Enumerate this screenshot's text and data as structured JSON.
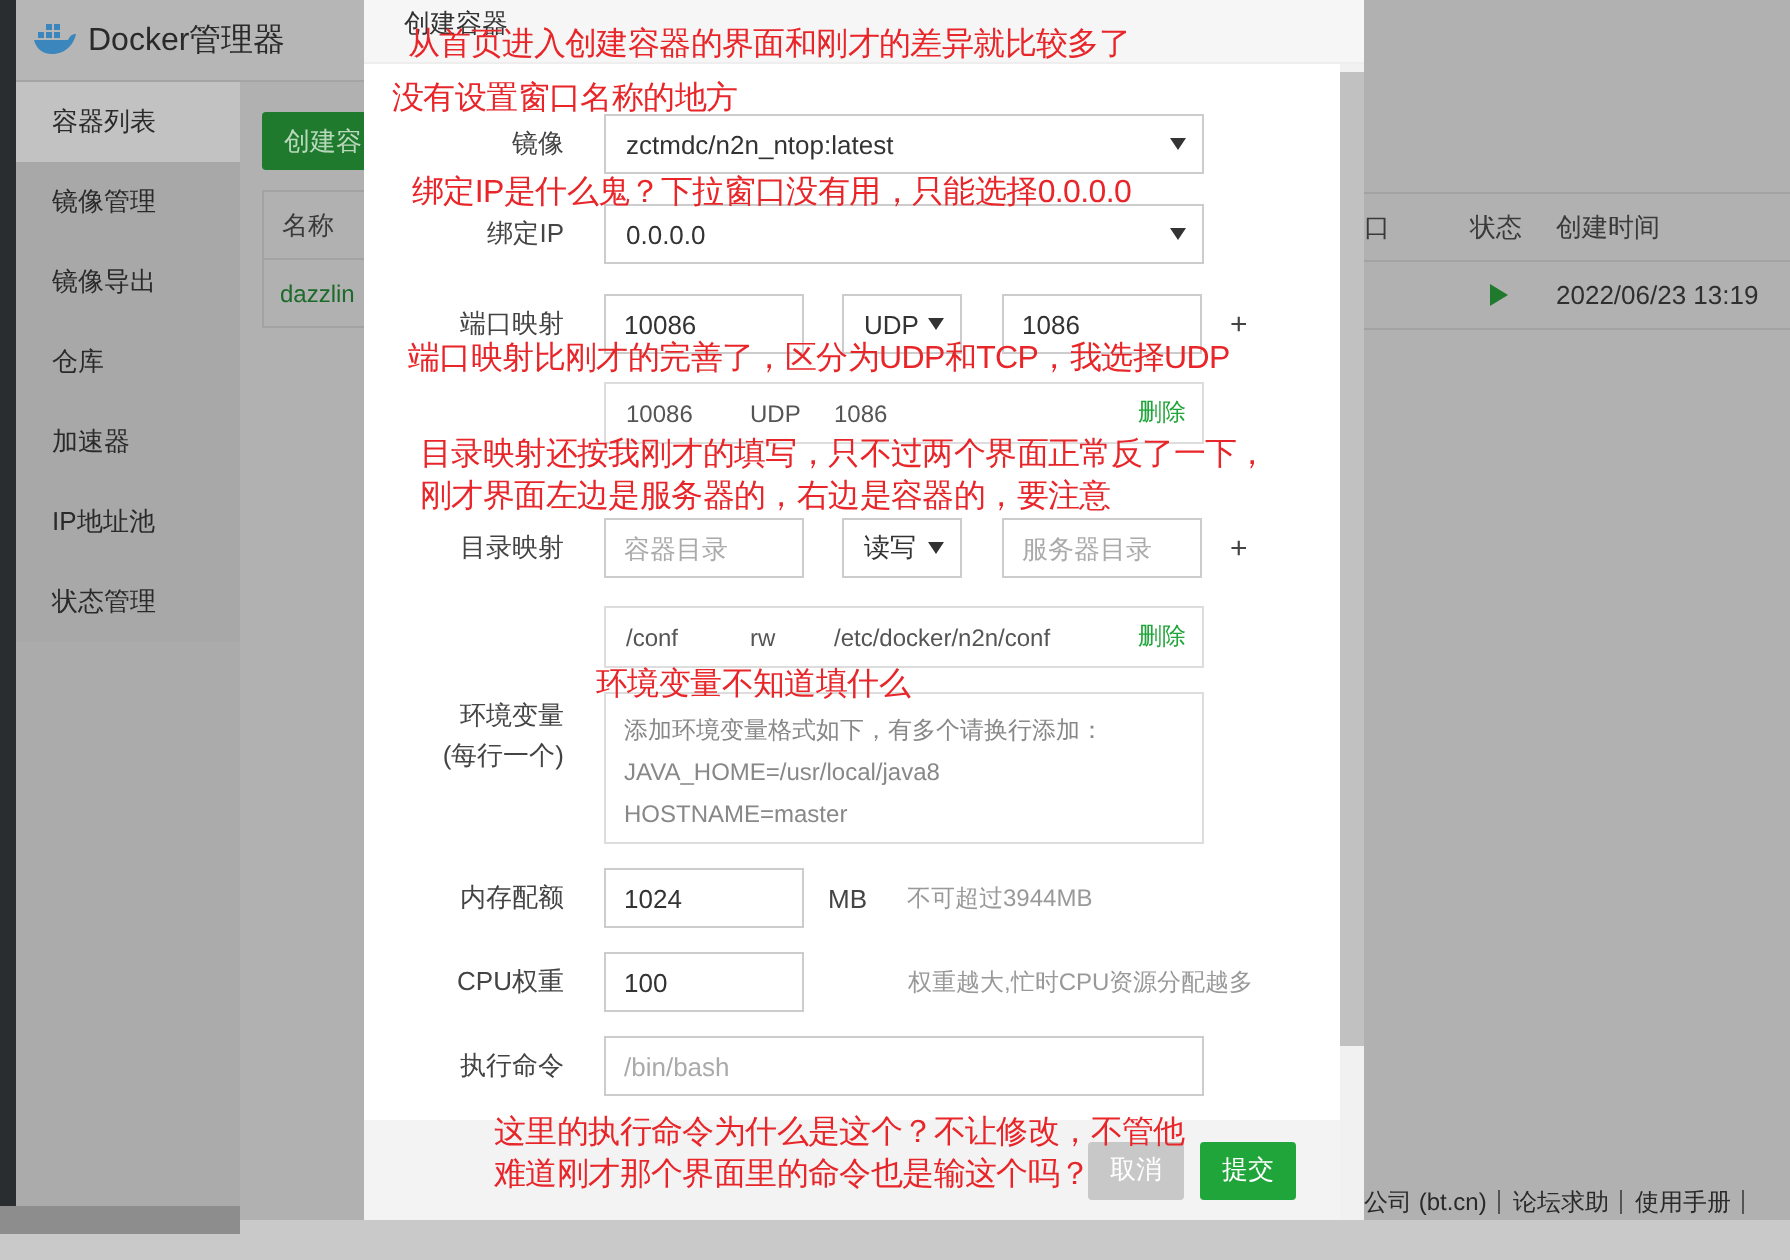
{
  "app": {
    "title": "Docker管理器",
    "sidebar": [
      {
        "label": "容器列表",
        "selected": true
      },
      {
        "label": "镜像管理",
        "selected": false
      },
      {
        "label": "镜像导出",
        "selected": false
      },
      {
        "label": "仓库",
        "selected": false
      },
      {
        "label": "加速器",
        "selected": false
      },
      {
        "label": "IP地址池",
        "selected": false
      },
      {
        "label": "状态管理",
        "selected": false
      }
    ],
    "create_button": "创建容",
    "table": {
      "columns": [
        "名称",
        "口",
        "状态",
        "创建时间"
      ],
      "rows": [
        {
          "name": "dazzlin",
          "running": true,
          "created": "2022/06/23 13:19"
        }
      ]
    },
    "footer_links": [
      "公司 (bt.cn)",
      "论坛求助",
      "使用手册"
    ]
  },
  "dialog": {
    "title": "创建容器",
    "fields": [
      {
        "kind": "select",
        "label": "镜像",
        "value": "zctmdc/n2n_ntop:latest"
      },
      {
        "kind": "select",
        "label": "绑定IP",
        "value": "0.0.0.0"
      },
      {
        "kind": "mapping",
        "label": "端口映射",
        "inputs": [
          {
            "kind": "input",
            "value": "10086"
          },
          {
            "kind": "select",
            "value": "UDP"
          },
          {
            "kind": "input",
            "value": "1086"
          }
        ],
        "add": "+",
        "entries": [
          {
            "cells": [
              "10086",
              "UDP",
              "1086"
            ],
            "delete": "删除"
          }
        ]
      },
      {
        "kind": "mapping",
        "label": "目录映射",
        "inputs": [
          {
            "kind": "input",
            "placeholder": "容器目录"
          },
          {
            "kind": "select",
            "value": "读写"
          },
          {
            "kind": "input",
            "placeholder": "服务器目录"
          }
        ],
        "add": "+",
        "entries": [
          {
            "cells": [
              "/conf",
              "rw",
              "/etc/docker/n2n/conf"
            ],
            "delete": "删除"
          }
        ]
      },
      {
        "kind": "textarea",
        "label": "环境变量",
        "sublabel": "(每行一个)",
        "placeholder": "添加环境变量格式如下，有多个请换行添加：\nJAVA_HOME=/usr/local/java8\nHOSTNAME=master"
      },
      {
        "kind": "input",
        "label": "内存配额",
        "value": "1024",
        "unit": "MB",
        "hint": "不可超过3944MB"
      },
      {
        "kind": "input",
        "label": "CPU权重",
        "value": "100",
        "hint": "权重越大,忙时CPU资源分配越多"
      },
      {
        "kind": "input",
        "label": "执行命令",
        "placeholder": "/bin/bash"
      }
    ],
    "buttons": [
      {
        "label": "取消",
        "disabled": true
      },
      {
        "label": "提交",
        "disabled": false
      }
    ]
  },
  "annotations": [
    {
      "lines": [
        "从首页进入创建容器的界面和刚才的差异就比较多了"
      ]
    },
    {
      "lines": [
        "没有设置窗口名称的地方"
      ]
    },
    {
      "lines": [
        "绑定IP是什么鬼？下拉窗口没有用，只能选择0.0.0.0"
      ]
    },
    {
      "lines": [
        "端口映射比刚才的完善了，区分为UDP和TCP，我选择UDP"
      ]
    },
    {
      "lines": [
        "目录映射还按我刚才的填写，只不过两个界面正常反了一下，",
        "刚才界面左边是服务器的，右边是容器的，要注意"
      ]
    },
    {
      "lines": [
        "环境变量不知道填什么"
      ]
    },
    {
      "lines": [
        "这里的执行命令为什么是这个？不让修改，不管他",
        "难道刚才那个界面里的命令也是输这个吗？"
      ]
    }
  ]
}
